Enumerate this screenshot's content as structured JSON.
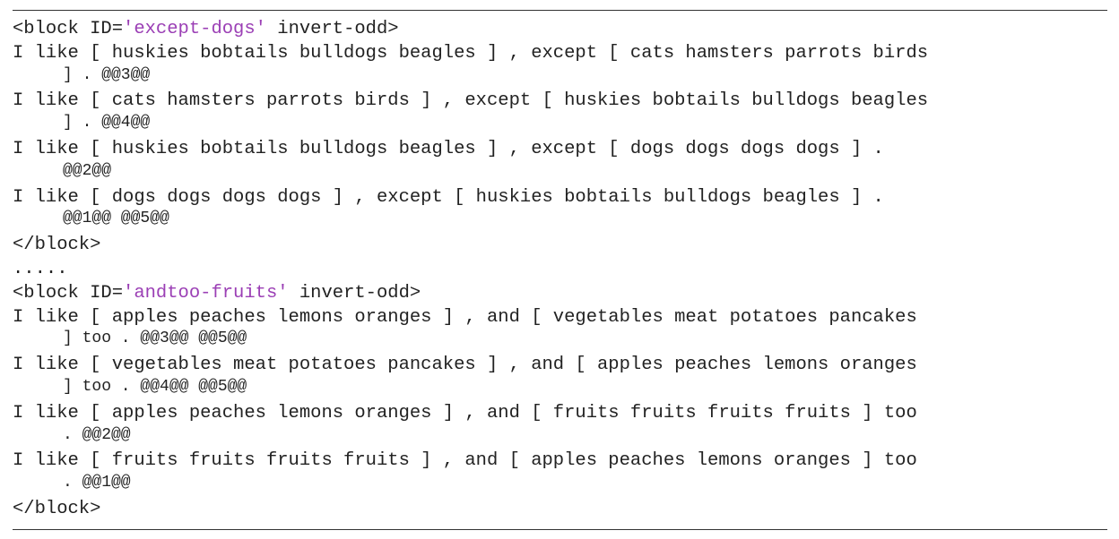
{
  "blocks": [
    {
      "open_prefix": "<block ID=",
      "id": "'except-dogs'",
      "open_suffix": " invert-odd>",
      "lines": [
        {
          "main": "I like [ huskies bobtails bulldogs beagles ] , except [ cats hamsters parrots birds",
          "cont": "] . @@3@@"
        },
        {
          "main": "I like [ cats hamsters parrots birds ] , except [ huskies bobtails bulldogs beagles",
          "cont": "] . @@4@@"
        },
        {
          "main": "I like [ huskies bobtails bulldogs beagles ] , except [ dogs dogs dogs dogs ] .",
          "cont": "@@2@@"
        },
        {
          "main": "I like [ dogs dogs dogs dogs ] , except [ huskies bobtails bulldogs beagles ] .",
          "cont": "@@1@@ @@5@@"
        }
      ],
      "close": "</block>"
    },
    {
      "open_prefix": "<block ID=",
      "id": "'andtoo-fruits'",
      "open_suffix": " invert-odd>",
      "lines": [
        {
          "main": "I like [ apples peaches lemons oranges ] , and [ vegetables meat potatoes pancakes",
          "cont": "] too . @@3@@ @@5@@"
        },
        {
          "main": "I like [ vegetables meat potatoes pancakes ] , and [ apples peaches lemons oranges",
          "cont": "] too . @@4@@ @@5@@"
        },
        {
          "main": "I like [ apples peaches lemons oranges ] , and [ fruits fruits fruits fruits ] too",
          "cont": ". @@2@@"
        },
        {
          "main": "I like [ fruits fruits fruits fruits ] , and [ apples peaches lemons oranges ] too",
          "cont": ". @@1@@"
        }
      ],
      "close": "</block>"
    }
  ],
  "separator": "....."
}
